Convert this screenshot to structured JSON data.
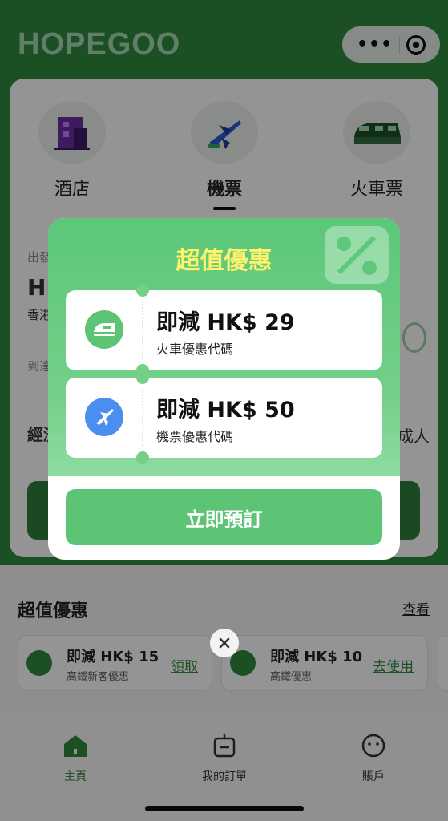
{
  "header": {
    "logo": "HOPEGOO"
  },
  "categories": [
    {
      "label": "酒店",
      "icon": "hotel-icon"
    },
    {
      "label": "機票",
      "icon": "plane-icon",
      "active": true
    },
    {
      "label": "火車票",
      "icon": "train-icon"
    }
  ],
  "form_fragments": {
    "depart_label": "出發",
    "depart_code": "HK",
    "depart_city": "香港",
    "arrive_label": "到達",
    "class_label": "經濟",
    "passenger_label": "成人"
  },
  "deals": {
    "title": "超值優惠",
    "more": "查看",
    "items": [
      {
        "title": "即減 HK$ 15",
        "subtitle": "高鐵新客優惠",
        "action": "領取"
      },
      {
        "title": "即減 HK$ 10",
        "subtitle": "高鐵優惠",
        "action": "去使用"
      }
    ]
  },
  "tabbar": {
    "items": [
      {
        "label": "主頁",
        "icon": "home-icon",
        "active": true
      },
      {
        "label": "我的訂單",
        "icon": "orders-icon"
      },
      {
        "label": "賬戶",
        "icon": "account-icon"
      }
    ]
  },
  "popup": {
    "title": "超值優惠",
    "coupons": [
      {
        "title": "即減 HK$ 29",
        "subtitle": "火車優惠代碼",
        "icon": "train-icon",
        "icon_color": "#5dc476"
      },
      {
        "title": "即減 HK$ 50",
        "subtitle": "機票優惠代碼",
        "icon": "plane-icon",
        "icon_color": "#4a8ff0"
      }
    ],
    "button": "立即預訂"
  },
  "colors": {
    "brand_green": "#2e8b3f",
    "popup_green": "#5dc476",
    "title_yellow": "#fff36b"
  }
}
